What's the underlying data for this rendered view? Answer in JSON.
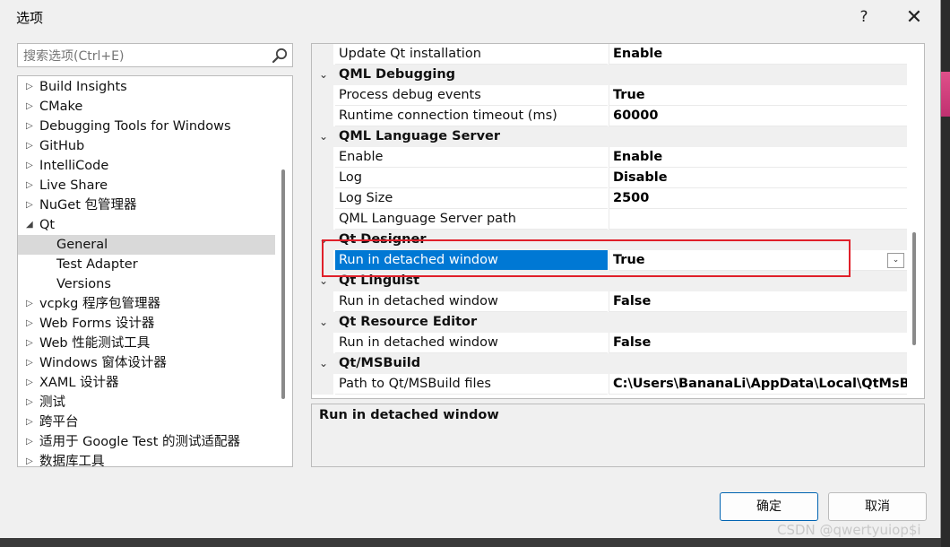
{
  "window": {
    "title": "选项",
    "help_glyph": "?",
    "close_glyph": "✕"
  },
  "search": {
    "placeholder": "搜索选项(Ctrl+E)"
  },
  "tree": {
    "items": [
      {
        "label": "Build Insights",
        "expander": "▷"
      },
      {
        "label": "CMake",
        "expander": "▷"
      },
      {
        "label": "Debugging Tools for Windows",
        "expander": "▷"
      },
      {
        "label": "GitHub",
        "expander": "▷"
      },
      {
        "label": "IntelliCode",
        "expander": "▷"
      },
      {
        "label": "Live Share",
        "expander": "▷"
      },
      {
        "label": "NuGet 包管理器",
        "expander": "▷"
      },
      {
        "label": "Qt",
        "expander": "◢"
      },
      {
        "label": "General",
        "expander": ""
      },
      {
        "label": "Test Adapter",
        "expander": ""
      },
      {
        "label": "Versions",
        "expander": ""
      },
      {
        "label": "vcpkg 程序包管理器",
        "expander": "▷"
      },
      {
        "label": "Web Forms 设计器",
        "expander": "▷"
      },
      {
        "label": "Web 性能测试工具",
        "expander": "▷"
      },
      {
        "label": "Windows 窗体设计器",
        "expander": "▷"
      },
      {
        "label": "XAML 设计器",
        "expander": "▷"
      },
      {
        "label": "测试",
        "expander": "▷"
      },
      {
        "label": "跨平台",
        "expander": "▷"
      },
      {
        "label": "适用于 Google Test 的测试适配器",
        "expander": "▷"
      },
      {
        "label": "数据库工具",
        "expander": "▷"
      }
    ]
  },
  "grid": {
    "rows": [
      {
        "name": "Update Qt installation",
        "value": "Enable"
      },
      {
        "category": "QML Debugging",
        "chevron": "⌄"
      },
      {
        "name": "Process debug events",
        "value": "True"
      },
      {
        "name": "Runtime connection timeout (ms)",
        "value": "60000"
      },
      {
        "category": "QML Language Server",
        "chevron": "⌄"
      },
      {
        "name": "Enable",
        "value": "Enable"
      },
      {
        "name": "Log",
        "value": "Disable"
      },
      {
        "name": "Log Size",
        "value": "2500"
      },
      {
        "name": "QML Language Server path",
        "value": ""
      },
      {
        "category": "Qt Designer",
        "chevron": "⌄"
      },
      {
        "name": "Run in detached window",
        "value": "True"
      },
      {
        "category": "Qt Linguist",
        "chevron": "⌄"
      },
      {
        "name": "Run in detached window",
        "value": "False"
      },
      {
        "category": "Qt Resource Editor",
        "chevron": "⌄"
      },
      {
        "name": "Run in detached window",
        "value": "False"
      },
      {
        "category": "Qt/MSBuild",
        "chevron": "⌄"
      },
      {
        "name": "Path to Qt/MSBuild files",
        "value": "C:\\Users\\BananaLi\\AppData\\Local\\QtMsBuild"
      }
    ],
    "dropdown_glyph": "⌄"
  },
  "description": {
    "title": "Run in detached window"
  },
  "buttons": {
    "ok": "确定",
    "cancel": "取消"
  },
  "watermark": "CSDN @qwertyuiop$i",
  "colors": {
    "selection": "#0078d4",
    "highlight_box": "#e0202a",
    "tree_selected": "#d9d9d9"
  }
}
